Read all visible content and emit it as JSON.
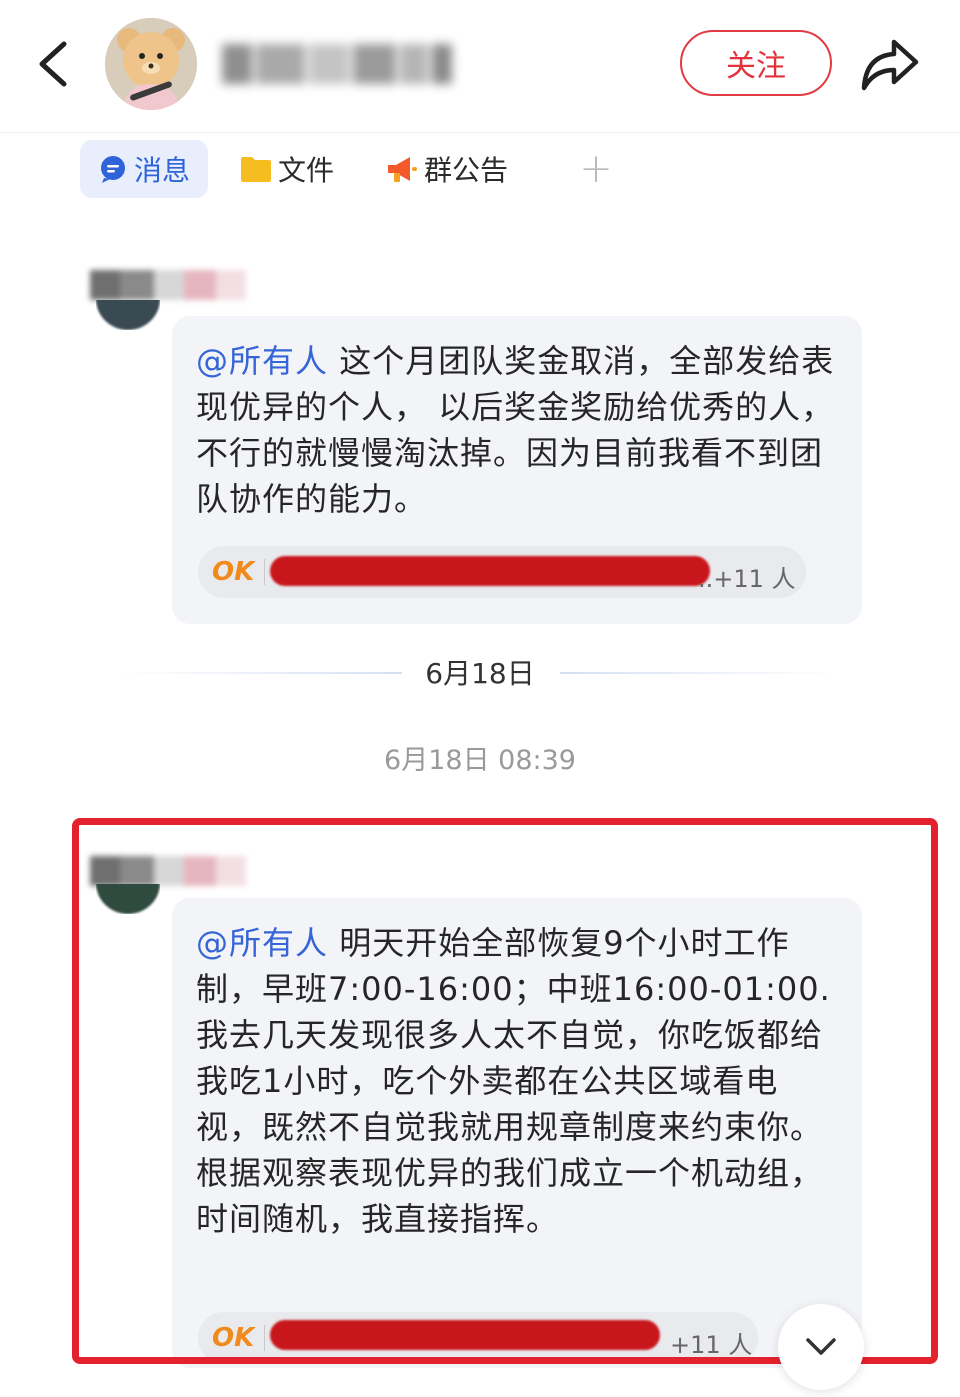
{
  "header": {
    "follow_label": "关注",
    "back_icon": "chevron-left-icon",
    "share_icon": "share-arrow-icon"
  },
  "tabs": [
    {
      "label": "消息",
      "icon": "chat-bubble-icon",
      "active": true
    },
    {
      "label": "文件",
      "icon": "folder-icon",
      "active": false
    },
    {
      "label": "群公告",
      "icon": "megaphone-icon",
      "active": false
    },
    {
      "label": "+",
      "icon": "plus-icon",
      "active": false
    }
  ],
  "messages": [
    {
      "mention": "@所有人",
      "text": " 这个月团队奖金取消，全部发给表现优异的个人， 以后奖金奖励给优秀的人，不行的就慢慢淘汰掉。因为目前我看不到团队协作的能力。",
      "reaction": {
        "emoji_text": "OK",
        "count_text": "..+11 人"
      }
    },
    {
      "mention": "@所有人",
      "text": " 明天开始全部恢复9个小时工作制，早班7:00-16:00；中班16:00-01:00. 我去几天发现很多人太不自觉，你吃饭都给我吃1小时，吃个外卖都在公共区域看电视，既然不自觉我就用规章制度来约束你。    根据观察表现优异的我们成立一个机动组，时间随机，我直接指挥。",
      "reaction": {
        "emoji_text": "OK",
        "count_text": "+11 人"
      }
    }
  ],
  "divider_date": "6月18日",
  "timestamp": "6月18日 08:39",
  "colors": {
    "accent_red": "#e2323d",
    "mention_blue": "#3565d6",
    "highlight_frame": "#e3222d",
    "reaction_ok": "#f08a1c"
  }
}
